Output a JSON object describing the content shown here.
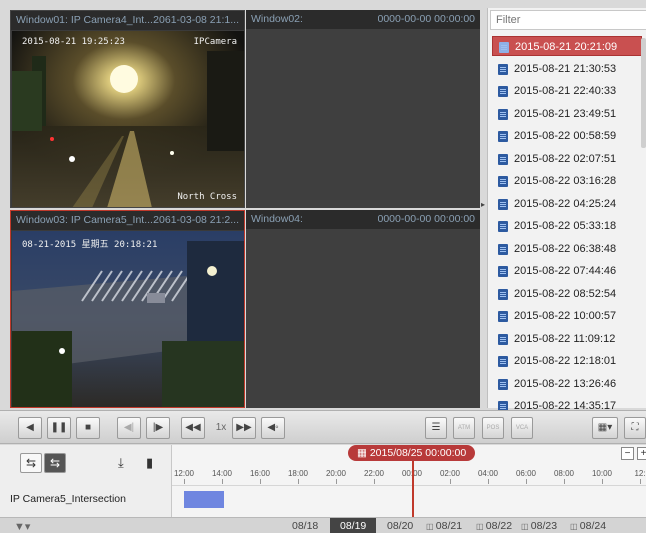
{
  "windows": [
    {
      "title": "Window01: IP Camera4_Int...",
      "time": "2061-03-08 21:1...",
      "osd_time": "2015-08-21 19:25:23",
      "osd_cam": "IPCamera",
      "osd_loc": "North Cross"
    },
    {
      "title": "Window02:",
      "time": "0000-00-00 00:00:00"
    },
    {
      "title": "Window03: IP Camera5_Int...",
      "time": "2061-03-08 21:2...",
      "osd_time": "08-21-2015 星期五 20:18:21"
    },
    {
      "title": "Window04:",
      "time": "0000-00-00 00:00:00"
    }
  ],
  "filelist": {
    "filter_placeholder": "Filter",
    "items": [
      "2015-08-21 20:21:09",
      "2015-08-21 21:30:53",
      "2015-08-21 22:40:33",
      "2015-08-21 23:49:51",
      "2015-08-22 00:58:59",
      "2015-08-22 02:07:51",
      "2015-08-22 03:16:28",
      "2015-08-22 04:25:24",
      "2015-08-22 05:33:18",
      "2015-08-22 06:38:48",
      "2015-08-22 07:44:46",
      "2015-08-22 08:52:54",
      "2015-08-22 10:00:57",
      "2015-08-22 11:09:12",
      "2015-08-22 12:18:01",
      "2015-08-22 13:26:46",
      "2015-08-22 14:35:17"
    ],
    "selected_index": 0
  },
  "controls": {
    "speed": "1x",
    "btn_atm": "ATM",
    "btn_pos": "POS",
    "btn_vca": "VCA"
  },
  "timeline": {
    "cursor_label": "2015/08/25 00:00:00",
    "ticks": [
      "12:00",
      "14:00",
      "16:00",
      "18:00",
      "20:00",
      "22:00",
      "00:00",
      "02:00",
      "04:00",
      "06:00",
      "08:00",
      "10:00",
      "12:"
    ],
    "camera": "IP Camera5_Intersection",
    "zoom_minus": "−",
    "zoom_plus": "+"
  },
  "dates": {
    "items": [
      "08/18",
      "08/19",
      "08/20",
      "08/21",
      "08/22",
      "08/23",
      "08/24"
    ],
    "selected": "08/19"
  },
  "colors": {
    "accent": "#c95050",
    "record": "#6f86e0",
    "cursor": "#c0392b"
  }
}
